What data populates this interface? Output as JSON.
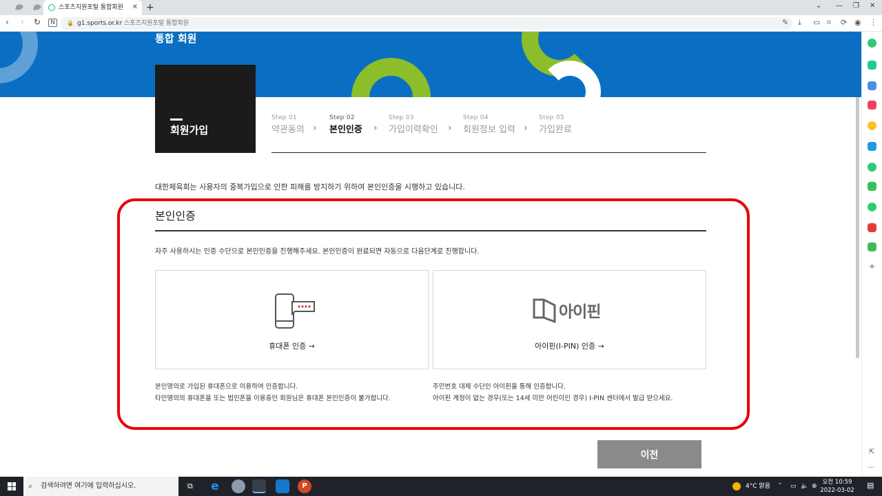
{
  "browser": {
    "tab_title": "스포츠지원포털 통합회원",
    "url_host": "g1.sports.or.kr",
    "url_title": "스포츠지원포털 통합회원"
  },
  "header": {
    "title": "통합 회원"
  },
  "joinbox": {
    "title": "회원가입"
  },
  "steps": [
    {
      "no": "Step 01",
      "label": "약관동의",
      "active": false
    },
    {
      "no": "Step 02",
      "label": "본인인증",
      "active": true
    },
    {
      "no": "Step 03",
      "label": "가입이력확인",
      "active": false
    },
    {
      "no": "Step 04",
      "label": "회원정보 입력",
      "active": false
    },
    {
      "no": "Step 05",
      "label": "가입완료",
      "active": false
    }
  ],
  "intro": "대한체육회는 사용자의 중복가입으로 인한 피해를 방지하기 위하여 본인인증을 시행하고 있습니다.",
  "auth": {
    "title": "본인인증",
    "desc": "자주 사용하시는 인증 수단으로 본인인증을 진행해주세요. 본인인증이 완료되면 자동으로 다음단계로 진행합니다.",
    "phone_label": "휴대폰 인증 →",
    "ipin_label": "아이핀(I-PIN) 인증 →",
    "ipin_logo_text": "아이핀",
    "phone_note_1": "본인명의로 가입된 휴대폰으로 이용하여 인증합니다.",
    "phone_note_2": "타인명의의 휴대폰을 또는 법인폰을 이용중인 회원님은 휴대폰 본인인증이 불가합니다.",
    "ipin_note_1": "주민번호 대체 수단인 아이핀을 통해 인증합니다.",
    "ipin_note_2": "아이핀 계정이 없는 경우(또는 14세 미만 어린이인 경우) I-PIN 센터에서 발급 받으세요."
  },
  "prev_button": "이전",
  "taskbar": {
    "search_placeholder": "검색하려면 여기에 입력하십시오.",
    "weather": "4°C  맑음",
    "time": "오전 10:59",
    "date": "2022-03-02"
  },
  "colors": {
    "banner": "#0a6fc2",
    "accent_green": "#8cbd2a",
    "highlight_red": "#e8000b",
    "joinbox": "#1b1b1b"
  }
}
